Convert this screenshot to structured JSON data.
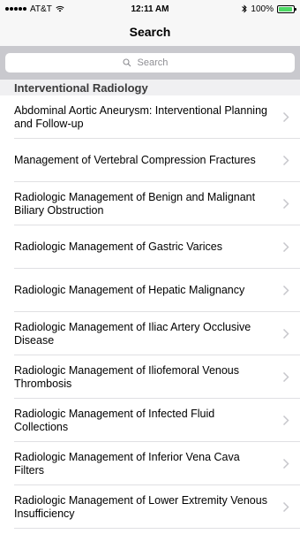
{
  "status": {
    "carrier": "AT&T",
    "time": "12:11 AM",
    "battery": "100%"
  },
  "nav": {
    "title": "Search"
  },
  "search": {
    "placeholder": "Search"
  },
  "section": {
    "title": "Interventional Radiology"
  },
  "items": [
    {
      "label": "Abdominal Aortic Aneurysm: Interventional Planning and Follow-up"
    },
    {
      "label": "Management of Vertebral Compression Fractures"
    },
    {
      "label": "Radiologic Management of Benign and Malignant Biliary Obstruction"
    },
    {
      "label": "Radiologic Management of Gastric Varices"
    },
    {
      "label": "Radiologic Management of Hepatic Malignancy"
    },
    {
      "label": "Radiologic Management of Iliac Artery Occlusive Disease"
    },
    {
      "label": "Radiologic Management of Iliofemoral Venous Thrombosis"
    },
    {
      "label": "Radiologic Management of Infected Fluid Collections"
    },
    {
      "label": "Radiologic Management of Inferior Vena Cava Filters"
    },
    {
      "label": "Radiologic Management of Lower Extremity Venous Insufficiency"
    }
  ],
  "colors": {
    "battery_fill": "#4cd964",
    "chevron": "#c7c7cc",
    "search_bar_bg": "#c9c9ce"
  }
}
